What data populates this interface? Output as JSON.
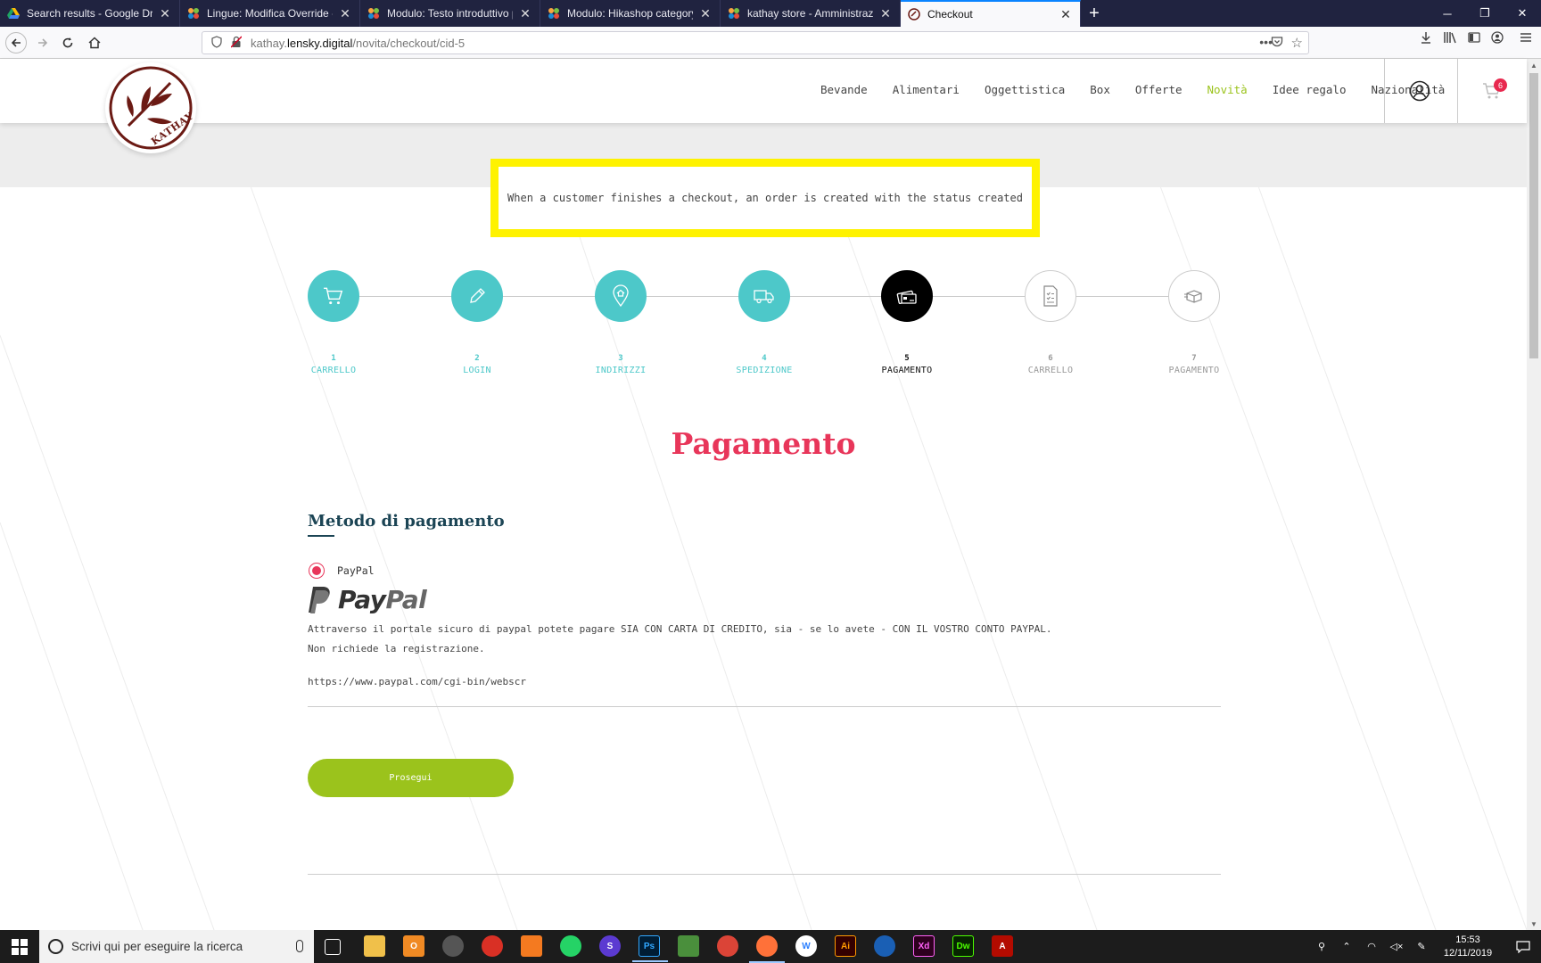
{
  "browser": {
    "tabs": [
      {
        "title": "Search results - Google Drive",
        "favicon": "google-drive-icon"
      },
      {
        "title": "Lingue: Modifica Override - kat",
        "favicon": "joomla-icon"
      },
      {
        "title": "Modulo: Testo introduttivo per",
        "favicon": "joomla-icon"
      },
      {
        "title": "Modulo: Hikashop category he",
        "favicon": "joomla-icon"
      },
      {
        "title": "kathay store - Amministrazione",
        "favicon": "joomla-icon"
      },
      {
        "title": "Checkout",
        "favicon": "kathay-icon",
        "active": true
      }
    ],
    "url": {
      "prefix": "kathay.",
      "domain": "lensky.digital",
      "path": "/novita/checkout/cid-5"
    }
  },
  "site": {
    "logo_text": "KATHAY",
    "menu": [
      {
        "label": "Bevande"
      },
      {
        "label": "Alimentari"
      },
      {
        "label": "Oggettistica"
      },
      {
        "label": "Box"
      },
      {
        "label": "Offerte"
      },
      {
        "label": "Novità",
        "highlight": true
      },
      {
        "label": "Idee regalo"
      },
      {
        "label": "Nazionalità"
      }
    ],
    "cart_count": "6",
    "accent": "#9bc31c",
    "teal": "#4dc8c9",
    "pink": "#e8365a"
  },
  "notice": "When a customer finishes a checkout, an order is created with the status created",
  "steps": [
    {
      "num": "1",
      "label": "CARRELLO",
      "state": "done",
      "icon": "cart-icon"
    },
    {
      "num": "2",
      "label": "LOGIN",
      "state": "done",
      "icon": "pencil-icon"
    },
    {
      "num": "3",
      "label": "INDIRIZZI",
      "state": "done",
      "icon": "location-pin-icon"
    },
    {
      "num": "4",
      "label": "SPEDIZIONE",
      "state": "done",
      "icon": "truck-icon"
    },
    {
      "num": "5",
      "label": "PAGAMENTO",
      "state": "current",
      "icon": "credit-card-icon"
    },
    {
      "num": "6",
      "label": "CARRELLO",
      "state": "todo",
      "icon": "checklist-icon"
    },
    {
      "num": "7",
      "label": "PAGAMENTO",
      "state": "todo",
      "icon": "package-icon"
    }
  ],
  "checkout": {
    "title": "Pagamento",
    "section_title": "Metodo di pagamento",
    "method_name": "PayPal",
    "paypal_logo_a": "Pay",
    "paypal_logo_b": "Pal",
    "description_line1": "Attraverso il portale sicuro di paypal potete pagare SIA CON CARTA DI CREDITO, sia - se lo avete - CON IL VOSTRO CONTO PAYPAL.",
    "description_line2": "Non richiede la registrazione.",
    "method_url": "https://www.paypal.com/cgi-bin/webscr",
    "continue_label": "Prosegui"
  },
  "taskbar": {
    "search_placeholder": "Scrivi qui per eseguire la ricerca",
    "time": "15:53",
    "date": "12/11/2019"
  }
}
